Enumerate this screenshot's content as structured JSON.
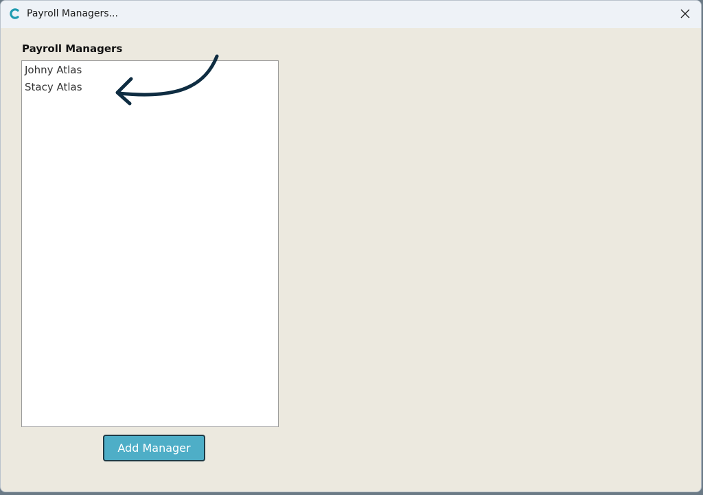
{
  "window": {
    "title": "Payroll Managers..."
  },
  "icons": {
    "app": "app-logo-icon",
    "close": "close-icon",
    "annotation": "curved-arrow-annotation"
  },
  "main": {
    "section_label": "Payroll Managers",
    "managers": [
      {
        "name": "Johny Atlas"
      },
      {
        "name": "Stacy Atlas"
      }
    ],
    "add_button_label": "Add Manager"
  },
  "colors": {
    "window_bg": "#ece9df",
    "titlebar_bg": "#eef2f7",
    "accent": "#4eaec7",
    "button_border": "#1e3a45",
    "annotation_arrow": "#0f2d42"
  }
}
